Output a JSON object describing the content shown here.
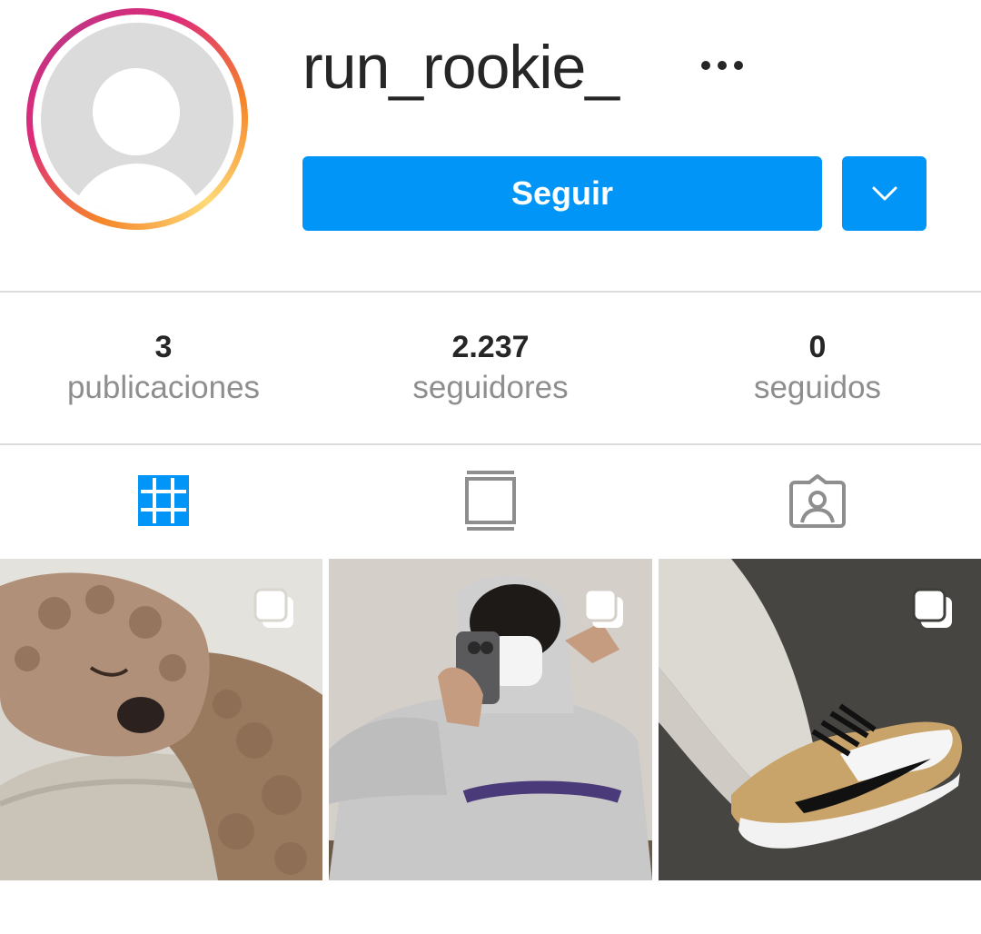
{
  "profile": {
    "username": "run_rookie_",
    "avatar_icon": "default-avatar-icon"
  },
  "actions": {
    "follow_label": "Seguir",
    "follow_color": "#0095f6",
    "more_icon": "more-horizontal-icon",
    "dropdown_icon": "chevron-down-icon"
  },
  "stats": [
    {
      "value": "3",
      "label": "publicaciones"
    },
    {
      "value": "2.237",
      "label": "seguidores"
    },
    {
      "value": "0",
      "label": "seguidos"
    }
  ],
  "tabs": [
    {
      "icon": "grid-icon",
      "active": true
    },
    {
      "icon": "igtv-icon",
      "active": false
    },
    {
      "icon": "tagged-icon",
      "active": false
    }
  ],
  "posts": [
    {
      "subject": "dog",
      "multi": true,
      "multi_icon": "carousel-icon"
    },
    {
      "subject": "mirror-selfie",
      "multi": true,
      "multi_icon": "carousel-icon"
    },
    {
      "subject": "sneakers",
      "multi": true,
      "multi_icon": "carousel-icon"
    }
  ]
}
